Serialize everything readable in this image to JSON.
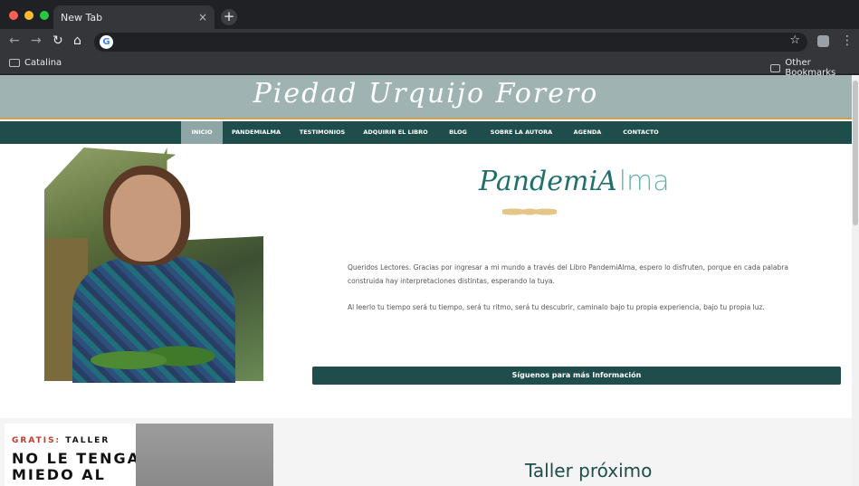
{
  "browser": {
    "tab_title": "New Tab",
    "tab_close": "×",
    "new_tab": "+",
    "bookmarks": [
      "Catalina"
    ],
    "other_bookmarks": "Other Bookmarks",
    "dot_colors": [
      "#ff5f57",
      "#febc2e",
      "#28c840"
    ]
  },
  "site": {
    "title": "Piedad Urquijo Forero",
    "menu": [
      "INICIO",
      "PANDEMIALMA",
      "TESTIMONIOS",
      "ADQUIRIR EL LIBRO",
      "BLOG",
      "SOBRE LA AUTORA",
      "AGENDA",
      "CONTACTO"
    ],
    "active_menu": "INICIO",
    "logo_part1": "PandemiA",
    "logo_part2": "lma",
    "paragraph1": "Queridos Lectores. Gracias por ingresar a mi mundo a través del Libro PandemiAlma, espero lo disfruten, porque en cada palabra construida hay interpretaciones distintas, esperando la tuya.",
    "paragraph2": "Al leerlo tu tiempo será tu tiempo, será tu ritmo, será tu descubrir, caminalo bajo tu propia experiencia, bajo tu propia luz.",
    "cta": "Síguenos para más Información",
    "promo_free": "GRATIS:",
    "promo_workshop": "TALLER",
    "promo_headline": "NO LE TENGAS MIEDO AL",
    "next_workshop": "Taller próximo"
  },
  "colors": {
    "header": "#9fb3b3",
    "menu": "#1e4d4c",
    "accent": "#c9a24a"
  }
}
